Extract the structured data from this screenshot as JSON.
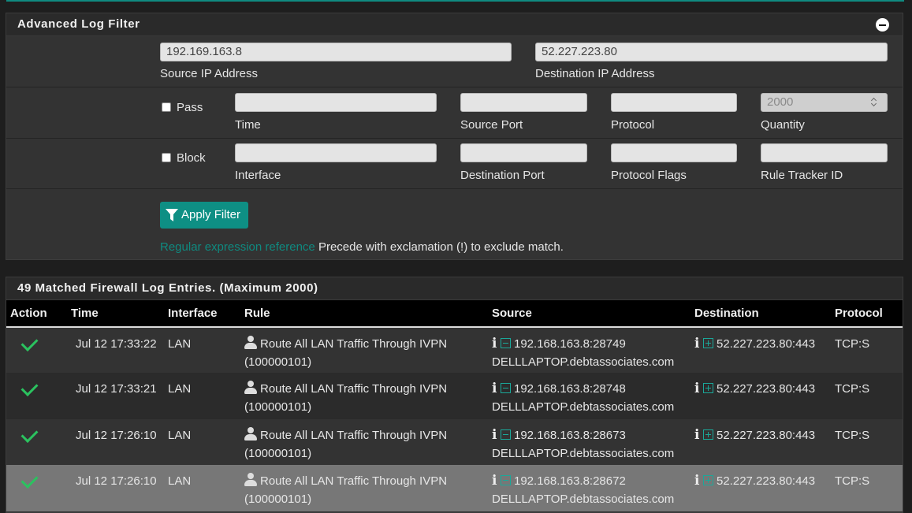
{
  "filter": {
    "title": "Advanced Log Filter",
    "source_ip": {
      "value": "192.169.163.8",
      "label": "Source IP Address"
    },
    "dest_ip": {
      "value": "52.227.223.80",
      "label": "Destination IP Address"
    },
    "pass": {
      "label": "Pass",
      "checked": false
    },
    "block": {
      "label": "Block",
      "checked": false
    },
    "time": {
      "value": "",
      "label": "Time"
    },
    "source_port": {
      "value": "",
      "label": "Source Port"
    },
    "protocol": {
      "value": "",
      "label": "Protocol"
    },
    "quantity": {
      "placeholder": "2000",
      "label": "Quantity"
    },
    "interface": {
      "value": "",
      "label": "Interface"
    },
    "dest_port": {
      "value": "",
      "label": "Destination Port"
    },
    "protocol_flags": {
      "value": "",
      "label": "Protocol Flags"
    },
    "rule_tracker": {
      "value": "",
      "label": "Rule Tracker ID"
    },
    "apply_label": "Apply Filter",
    "regex_link": "Regular expression reference",
    "regex_note": "Precede with exclamation (!) to exclude match."
  },
  "log": {
    "title": "49 Matched Firewall Log Entries. (Maximum 2000)",
    "columns": [
      "Action",
      "Time",
      "Interface",
      "Rule",
      "Source",
      "Destination",
      "Protocol"
    ],
    "rows": [
      {
        "time": "Jul 12 17:33:22",
        "interface": "LAN",
        "rule": "Route All LAN Traffic Through IVPN",
        "rule_id": "(100000101)",
        "source": "192.168.163.8:28749",
        "source_host": "DELLLAPTOP.debtassociates.com",
        "destination": "52.227.223.80:443",
        "protocol": "TCP:S"
      },
      {
        "time": "Jul 12 17:33:21",
        "interface": "LAN",
        "rule": "Route All LAN Traffic Through IVPN",
        "rule_id": "(100000101)",
        "source": "192.168.163.8:28748",
        "source_host": "DELLLAPTOP.debtassociates.com",
        "destination": "52.227.223.80:443",
        "protocol": "TCP:S"
      },
      {
        "time": "Jul 12 17:26:10",
        "interface": "LAN",
        "rule": "Route All LAN Traffic Through IVPN",
        "rule_id": "(100000101)",
        "source": "192.168.163.8:28673",
        "source_host": "DELLLAPTOP.debtassociates.com",
        "destination": "52.227.223.80:443",
        "protocol": "TCP:S"
      },
      {
        "time": "Jul 12 17:26:10",
        "interface": "LAN",
        "rule": "Route All LAN Traffic Through IVPN",
        "rule_id": "(100000101)",
        "source": "192.168.163.8:28672",
        "source_host": "DELLLAPTOP.debtassociates.com",
        "destination": "52.227.223.80:443",
        "protocol": "TCP:S"
      }
    ]
  },
  "colors": {
    "accent": "#0e8f84",
    "pass_check": "#2bc25f",
    "highlight_row": "#777777"
  }
}
